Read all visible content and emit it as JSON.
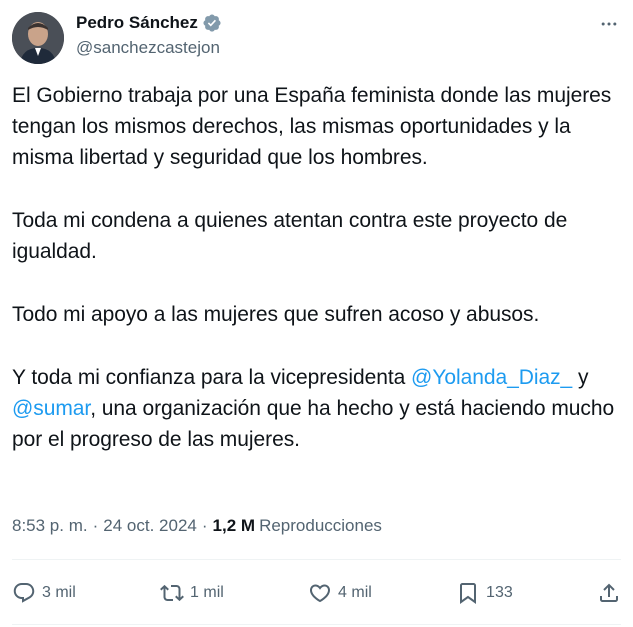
{
  "author": {
    "display_name": "Pedro Sánchez",
    "handle": "@sanchezcastejon",
    "verified": true,
    "verified_color": "#829aab"
  },
  "tweet": {
    "paragraph_1": "El Gobierno trabaja por una España feminista donde las mujeres tengan los mismos derechos, las mismas oportunidades y la misma libertad y seguridad que los hombres.",
    "paragraph_2": "Toda mi condena a quienes atentan contra este proyecto de igualdad.",
    "paragraph_3": "Todo mi apoyo a las mujeres que sufren acoso y abusos.",
    "paragraph_4": {
      "part_1": "Y toda mi confianza para la vicepresidenta ",
      "mention_1": "@Yolanda_Diaz_",
      "part_2": " y ",
      "mention_2": "@sumar",
      "part_3": ", una organización que ha hecho y está haciendo mucho por el progreso de las mujeres."
    }
  },
  "meta": {
    "time": "8:53 p. m.",
    "separator": "·",
    "date": "24 oct. 2024",
    "views_count": "1,2 M",
    "views_label": "Reproducciones"
  },
  "actions": {
    "replies": "3 mil",
    "reposts": "1 mil",
    "likes": "4 mil",
    "bookmarks": "133"
  },
  "colors": {
    "text": "#0f1419",
    "secondary": "#536471",
    "link": "#1d9bf0",
    "divider": "#eff3f4"
  },
  "icons": [
    "more-icon",
    "verified-badge-icon",
    "reply-icon",
    "repost-icon",
    "like-icon",
    "bookmark-icon",
    "share-icon"
  ]
}
